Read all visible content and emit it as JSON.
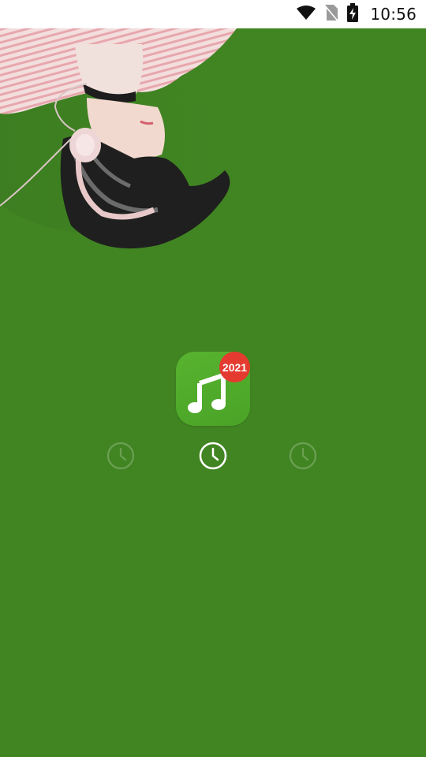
{
  "status_bar": {
    "time": "10:56",
    "icons": [
      "wifi-icon",
      "no-sim-icon",
      "battery-charging-icon"
    ]
  },
  "hero": {
    "image": "woman-lying-with-headphones-photo"
  },
  "app": {
    "icon": "music-note-icon",
    "badge": "2021"
  },
  "timer_indicators": {
    "icons": [
      "clock-icon",
      "clock-icon",
      "clock-icon"
    ],
    "active_index": 1
  },
  "colors": {
    "background": "#418523",
    "app_icon": "#4faa2a",
    "badge": "#e53a2f",
    "status_bar": "#ffffff"
  }
}
